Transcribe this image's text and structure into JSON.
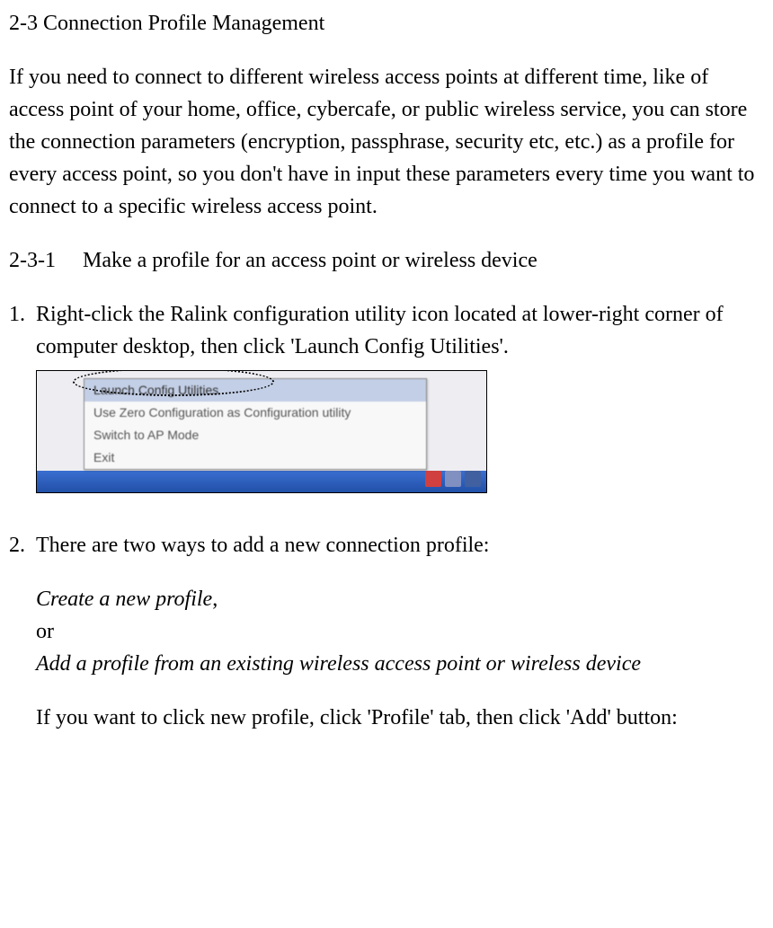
{
  "heading": "2-3 Connection Profile Management",
  "intro": "If you need to connect to different wireless access points at different time, like of access point of your home, office, cybercafe, or public wireless service, you can store the connection parameters (encryption, passphrase, security etc, etc.) as a profile for every access point, so you don't have in input these parameters every time you want to connect to a specific wireless access point.",
  "subheading_num": "2-3-1",
  "subheading_text": "Make a profile for an access point or wireless device",
  "step1_num": "1.",
  "step1_text": "Right-click the Ralink configuration utility icon located at lower-right corner of computer desktop, then click 'Launch Config Utilities'.",
  "menu": {
    "items": [
      "Launch Config Utilities",
      "Use Zero Configuration as Configuration utility",
      "Switch to AP Mode",
      "Exit"
    ]
  },
  "step2_num": "2.",
  "step2_text": "There are two ways to add a new connection profile:",
  "option1": "Create a new profile",
  "comma": ",",
  "or_text": "or",
  "option2": "Add a profile from an existing wireless access point or wireless device",
  "step2_followup": "If you want to click new profile, click 'Profile' tab, then click 'Add' button:"
}
